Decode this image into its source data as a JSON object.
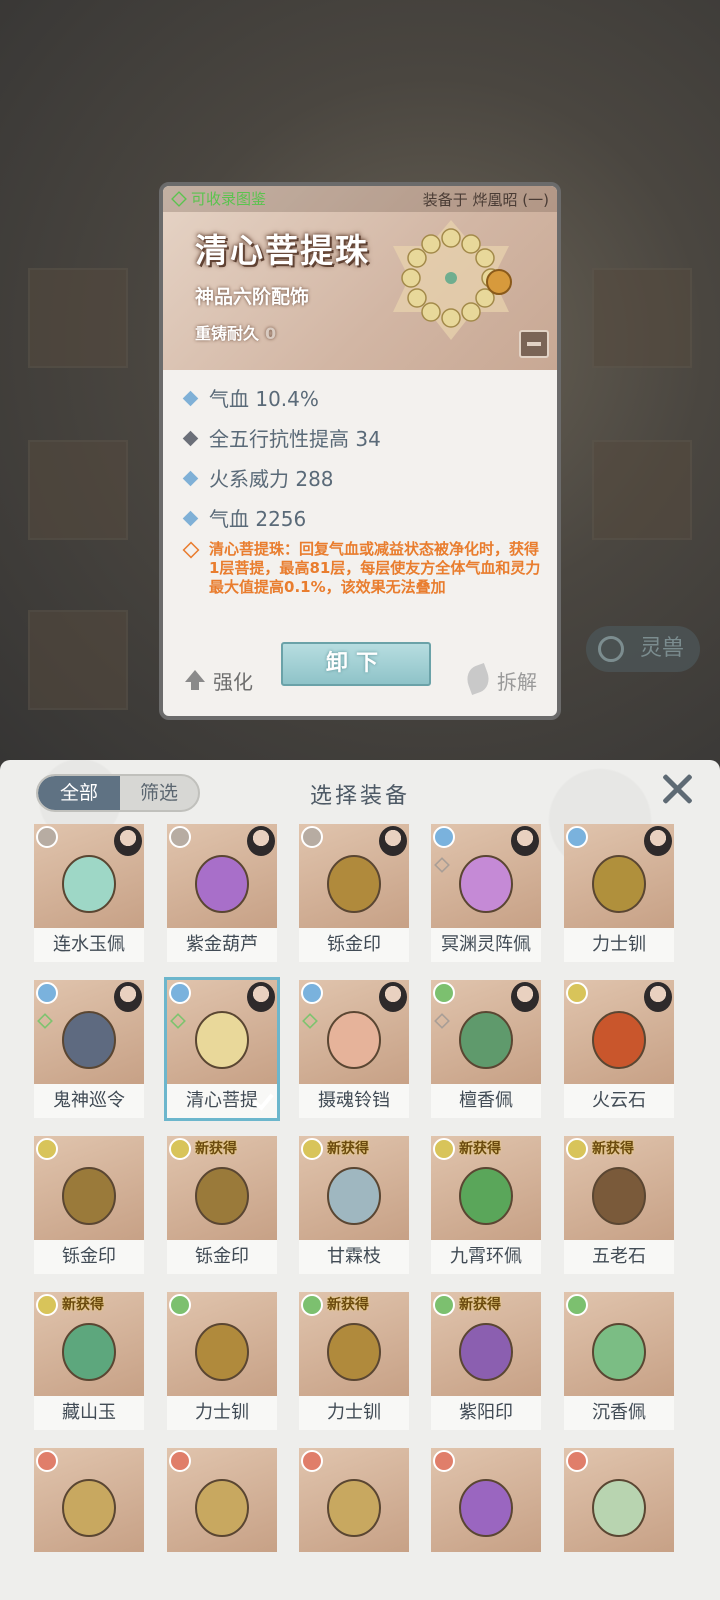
{
  "detail": {
    "collect_tag": "可收录图鉴",
    "equipped_on": "装备于 烨凰昭 (一)",
    "name": "清心菩提珠",
    "grade": "神品六阶配饰",
    "durability_label": "重铸耐久",
    "durability_value": "0",
    "stats": [
      "气血 10.4%",
      "全五行抗性提高 34",
      "火系威力 288",
      "气血 2256"
    ],
    "passive": "清心菩提珠：回复气血或减益状态被净化时，获得1层菩提，最高81层，每层使友方全体气血和灵力最大值提高0.1%，该效果无法叠加",
    "btn_strengthen": "强化",
    "btn_unequip": "卸下",
    "btn_dismantle": "拆解"
  },
  "background": {
    "pill_label": "灵兽"
  },
  "sheet": {
    "tab_all": "全部",
    "tab_filter": "筛选",
    "title": "选择装备",
    "new_tag": "新获得",
    "items": [
      {
        "label": "连水玉佩",
        "elem": "grey",
        "avatar": true,
        "new": false
      },
      {
        "label": "紫金葫芦",
        "elem": "grey",
        "avatar": true,
        "new": false
      },
      {
        "label": "铄金印",
        "elem": "grey",
        "avatar": true,
        "new": false
      },
      {
        "label": "冥渊灵阵佩",
        "elem": "blue",
        "avatar": true,
        "new": false
      },
      {
        "label": "力士钏",
        "elem": "blue",
        "avatar": true,
        "new": false
      },
      {
        "label": "鬼神巡令",
        "elem": "blue",
        "avatar": true,
        "new": false
      },
      {
        "label": "清心菩提",
        "elem": "blue",
        "avatar": true,
        "new": false,
        "selected": true
      },
      {
        "label": "摄魂铃铛",
        "elem": "blue",
        "avatar": true,
        "new": false
      },
      {
        "label": "檀香佩",
        "elem": "green",
        "avatar": true,
        "new": false
      },
      {
        "label": "火云石",
        "elem": "yellow",
        "avatar": true,
        "new": false
      },
      {
        "label": "铄金印",
        "elem": "yellow",
        "avatar": false,
        "new": false
      },
      {
        "label": "铄金印",
        "elem": "yellow",
        "avatar": false,
        "new": true
      },
      {
        "label": "甘霖枝",
        "elem": "yellow",
        "avatar": false,
        "new": true
      },
      {
        "label": "九霄环佩",
        "elem": "yellow",
        "avatar": false,
        "new": true
      },
      {
        "label": "五老石",
        "elem": "yellow",
        "avatar": false,
        "new": true
      },
      {
        "label": "藏山玉",
        "elem": "yellow",
        "avatar": false,
        "new": true
      },
      {
        "label": "力士钏",
        "elem": "green",
        "avatar": false,
        "new": false
      },
      {
        "label": "力士钏",
        "elem": "green",
        "avatar": false,
        "new": true
      },
      {
        "label": "紫阳印",
        "elem": "green",
        "avatar": false,
        "new": true
      },
      {
        "label": "沉香佩",
        "elem": "green",
        "avatar": false,
        "new": false
      },
      {
        "label": "",
        "elem": "red",
        "avatar": false,
        "new": false
      },
      {
        "label": "",
        "elem": "red",
        "avatar": false,
        "new": false
      },
      {
        "label": "",
        "elem": "red",
        "avatar": false,
        "new": false
      },
      {
        "label": "",
        "elem": "red",
        "avatar": false,
        "new": false
      },
      {
        "label": "",
        "elem": "red",
        "avatar": false,
        "new": false
      }
    ]
  }
}
